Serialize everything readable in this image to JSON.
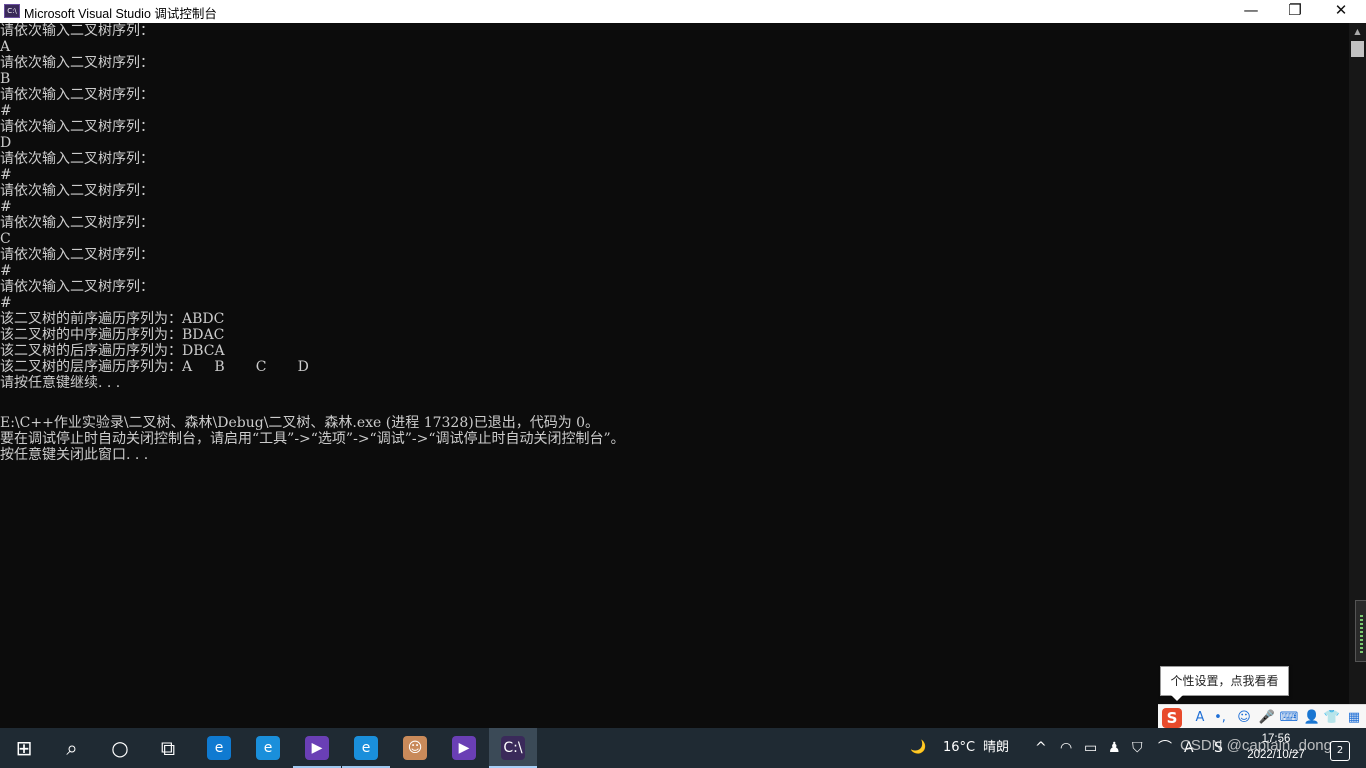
{
  "window": {
    "title": "Microsoft Visual Studio 调试控制台",
    "icon_text": "C:\\",
    "minimize_symbol": "—",
    "restore_symbol": "❐",
    "close_symbol": "✕"
  },
  "console": {
    "lines": [
      "请依次输入二叉树序列：",
      "A",
      "请依次输入二叉树序列：",
      "B",
      "请依次输入二叉树序列：",
      "#",
      "请依次输入二叉树序列：",
      "D",
      "请依次输入二叉树序列：",
      "#",
      "请依次输入二叉树序列：",
      "#",
      "请依次输入二叉树序列：",
      "C",
      "请依次输入二叉树序列：",
      "#",
      "请依次输入二叉树序列：",
      "#",
      "该二叉树的前序遍历序列为：ABDC",
      "该二叉树的中序遍历序列为：BDAC",
      "该二叉树的后序遍历序列为：DBCA",
      "该二叉树的层序遍历序列为：A     B       C       D",
      "请按任意键继续. . .",
      "",
      "E:\\C++作业实验录\\二叉树、森林\\Debug\\二叉树、森林.exe (进程 17328)已退出，代码为 0。",
      "要在调试停止时自动关闭控制台，请启用“工具”->“选项”->“调试”->“调试停止时自动关闭控制台”。",
      "按任意键关闭此窗口. . ."
    ]
  },
  "tooltip": {
    "text": "个性设置，点我看看"
  },
  "ime_toolbar": {
    "items": [
      {
        "name": "sogou-logo-icon",
        "glyph": "S"
      },
      {
        "name": "font-icon",
        "glyph": "A"
      },
      {
        "name": "punctuation-icon",
        "glyph": "•,"
      },
      {
        "name": "emoji-icon",
        "glyph": "☺"
      },
      {
        "name": "microphone-icon",
        "glyph": "🎤"
      },
      {
        "name": "keyboard-icon",
        "glyph": "⌨"
      },
      {
        "name": "user-icon",
        "glyph": "👤"
      },
      {
        "name": "skin-icon",
        "glyph": "👕"
      },
      {
        "name": "toolbox-icon",
        "glyph": "▦"
      }
    ]
  },
  "taskbar": {
    "apps": [
      {
        "name": "start-icon",
        "glyph": "⊞"
      },
      {
        "name": "search-icon",
        "glyph": "⌕"
      },
      {
        "name": "cortana-icon",
        "glyph": "○"
      },
      {
        "name": "task-view-icon",
        "glyph": "⧉"
      },
      {
        "name": "edge-icon",
        "glyph": "e"
      },
      {
        "name": "edge-beta-icon",
        "glyph": "e"
      },
      {
        "name": "visual-studio-icon",
        "glyph": "▶"
      },
      {
        "name": "edge-dev-icon",
        "glyph": "e"
      },
      {
        "name": "avatar-app-icon",
        "glyph": "☺"
      },
      {
        "name": "visual-studio-2-icon",
        "glyph": "▶"
      },
      {
        "name": "console-app-icon",
        "glyph": "C:\\"
      }
    ],
    "weather": {
      "glyph": "🌙",
      "temperature": "16°C",
      "condition": "晴朗"
    },
    "tray_icons": [
      "^",
      "◠",
      "▭",
      "♟",
      "⛉",
      "⌒",
      "A",
      "S"
    ],
    "clock": {
      "time": "17:56",
      "date": "2022/10/27"
    },
    "notification_count": "2"
  },
  "watermark": "CSDN @captain_dong",
  "colors": {
    "console_bg": "#0c0c0c",
    "console_text": "#cccccc",
    "taskbar_bg": "#1f2a33",
    "titlebar_bg": "#ffffff"
  }
}
